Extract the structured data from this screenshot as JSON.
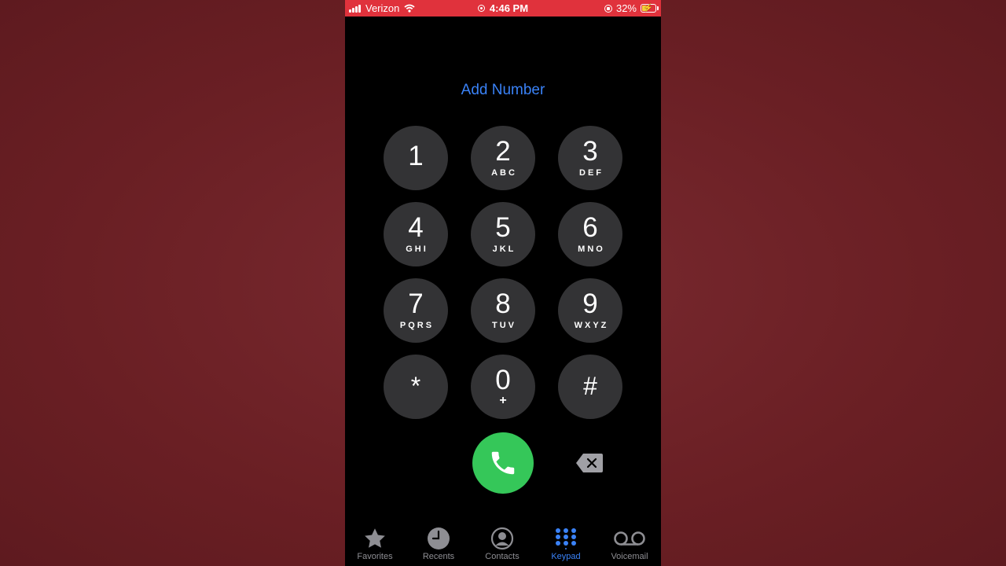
{
  "status_bar": {
    "carrier": "Verizon",
    "time": "4:46 PM",
    "battery": "32%",
    "battery_level": 0.32
  },
  "add_number_label": "Add Number",
  "keypad": {
    "keys": [
      {
        "digit": "1",
        "letters": ""
      },
      {
        "digit": "2",
        "letters": "ABC"
      },
      {
        "digit": "3",
        "letters": "DEF"
      },
      {
        "digit": "4",
        "letters": "GHI"
      },
      {
        "digit": "5",
        "letters": "JKL"
      },
      {
        "digit": "6",
        "letters": "MNO"
      },
      {
        "digit": "7",
        "letters": "PQRS"
      },
      {
        "digit": "8",
        "letters": "TUV"
      },
      {
        "digit": "9",
        "letters": "WXYZ"
      },
      {
        "digit": "*",
        "letters": ""
      },
      {
        "digit": "0",
        "letters": "+"
      },
      {
        "digit": "#",
        "letters": ""
      }
    ]
  },
  "tabs": [
    {
      "label": "Favorites",
      "icon": "star-icon"
    },
    {
      "label": "Recents",
      "icon": "clock-icon"
    },
    {
      "label": "Contacts",
      "icon": "person-circle-icon"
    },
    {
      "label": "Keypad",
      "icon": "keypad-grid-icon",
      "active": true
    },
    {
      "label": "Voicemail",
      "icon": "voicemail-icon"
    }
  ],
  "colors": {
    "status_bar": "#e0323c",
    "accent": "#3a82f7",
    "call_button": "#35c759",
    "key_background": "#333335",
    "page_background": "#6a1f24"
  }
}
